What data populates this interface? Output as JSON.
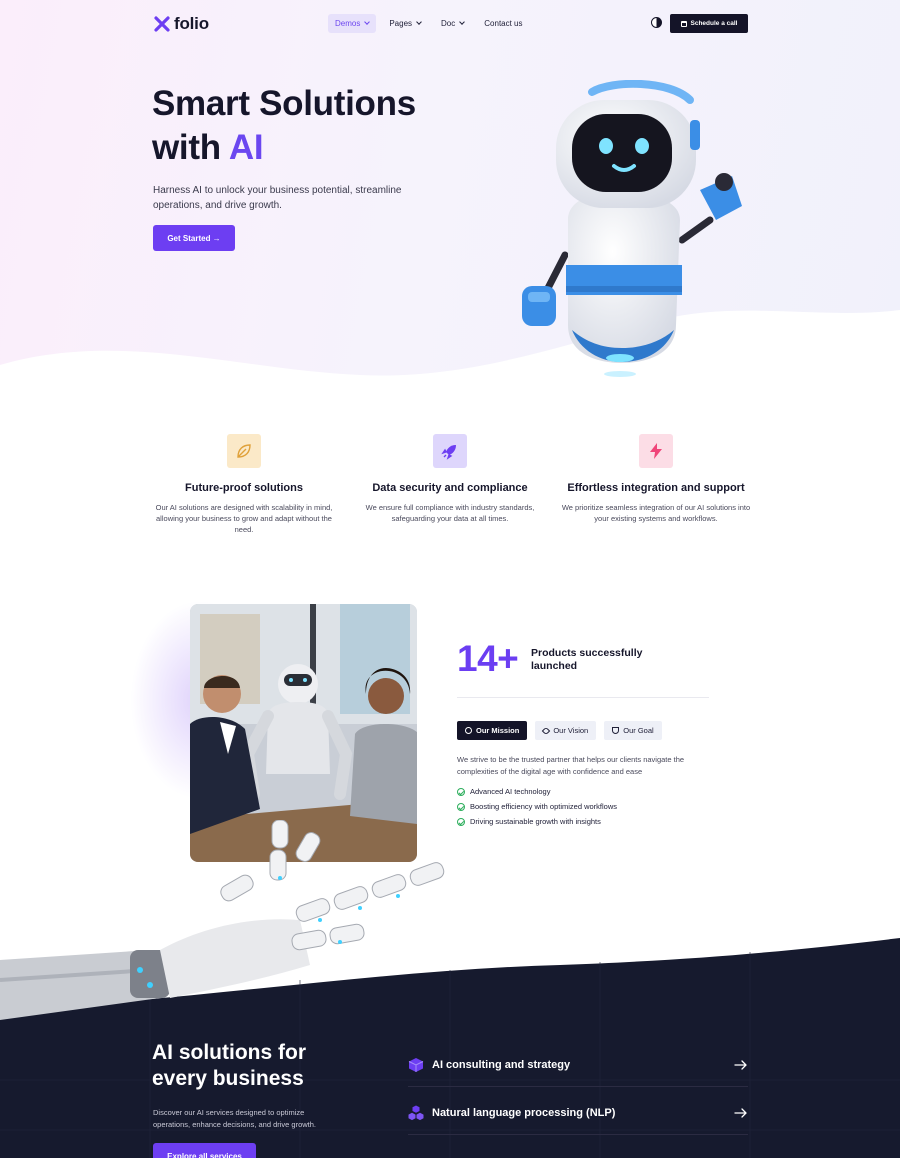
{
  "header": {
    "logo_text": "folio",
    "nav": [
      {
        "label": "Demos",
        "has_dropdown": true,
        "active": true
      },
      {
        "label": "Pages",
        "has_dropdown": true
      },
      {
        "label": "Doc",
        "has_dropdown": true
      },
      {
        "label": "Contact us"
      }
    ],
    "cta_label": "Schedule a call"
  },
  "hero": {
    "title_line1": "Smart Solutions",
    "title_line2_prefix": "with ",
    "title_line2_accent": "AI",
    "description": "Harness AI to unlock your business potential, streamline operations, and drive growth.",
    "button_label": "Get Started →"
  },
  "features": [
    {
      "icon": "leaf-icon",
      "title": "Future-proof solutions",
      "description": "Our AI solutions are designed with scalability in mind, allowing your business to grow and adapt without the need."
    },
    {
      "icon": "rocket-icon",
      "title": "Data security and compliance",
      "description": "We ensure full compliance with industry standards, safeguarding your data at all times."
    },
    {
      "icon": "lightning-icon",
      "title": "Effortless integration and support",
      "description": "We prioritize seamless integration of our AI solutions into your existing systems and workflows."
    }
  ],
  "about": {
    "stat_number": "14+",
    "stat_label": "Products successfully launched",
    "tabs": [
      {
        "label": "Our Mission",
        "icon": "target-icon",
        "active": true
      },
      {
        "label": "Our Vision",
        "icon": "eye-icon"
      },
      {
        "label": "Our Goal",
        "icon": "trophy-icon"
      }
    ],
    "description": "We strive to be the trusted partner that helps our clients navigate the complexities of the digital age with confidence and ease",
    "checklist": [
      "Advanced AI technology",
      "Boosting efficiency with optimized workflows",
      "Driving sustainable growth with insights"
    ]
  },
  "services": {
    "title_line1": "AI solutions for",
    "title_line2": "every business",
    "description": "Discover our AI services designed to optimize operations, enhance decisions, and drive growth.",
    "button_label": "Explore all services",
    "items": [
      {
        "label": "AI consulting and strategy",
        "icon": "cube-icon"
      },
      {
        "label": "Natural language processing (NLP)",
        "icon": "cubes-icon"
      }
    ]
  },
  "colors": {
    "accent": "#6d3ef2",
    "dark": "#141428",
    "dark_section": "#161a2e",
    "check": "#2cae5c"
  }
}
